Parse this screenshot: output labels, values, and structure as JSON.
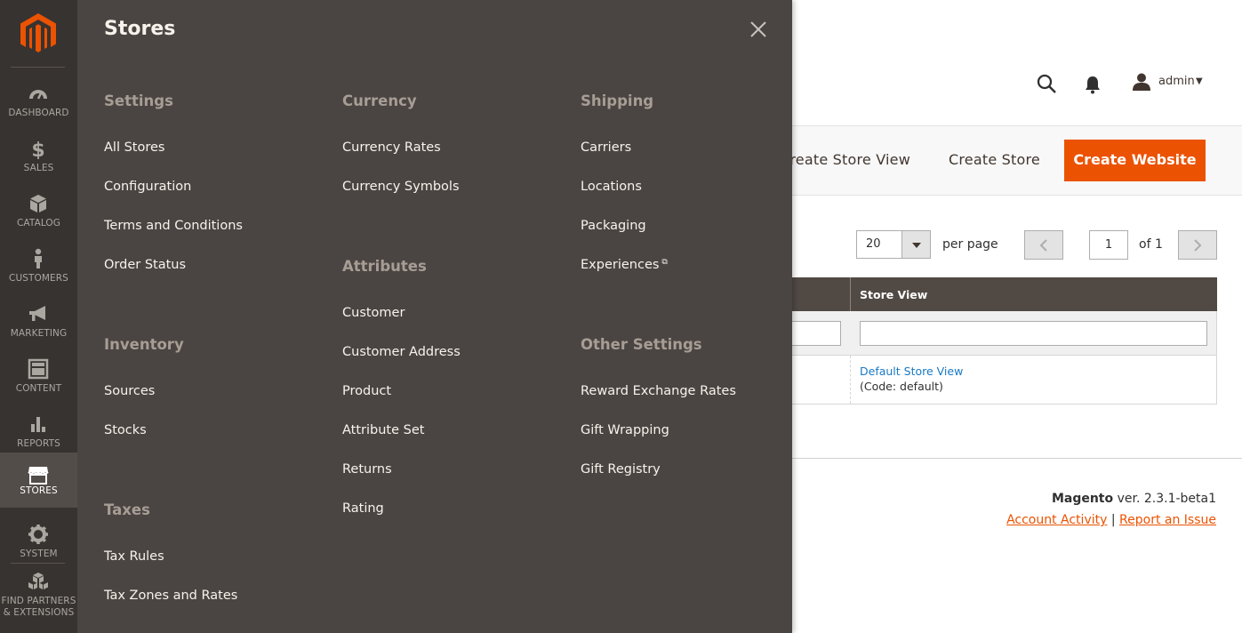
{
  "sidebar": {
    "items": [
      {
        "label": "DASHBOARD",
        "icon": "dashboard-icon"
      },
      {
        "label": "SALES",
        "icon": "dollar-icon"
      },
      {
        "label": "CATALOG",
        "icon": "box-icon"
      },
      {
        "label": "CUSTOMERS",
        "icon": "person-icon"
      },
      {
        "label": "MARKETING",
        "icon": "megaphone-icon"
      },
      {
        "label": "CONTENT",
        "icon": "layout-icon"
      },
      {
        "label": "REPORTS",
        "icon": "bar-chart-icon"
      },
      {
        "label": "STORES",
        "icon": "storefront-icon"
      },
      {
        "label": "SYSTEM",
        "icon": "gear-icon"
      },
      {
        "label_line1": "FIND PARTNERS",
        "label_line2": "& EXTENSIONS",
        "icon": "cubes-icon"
      }
    ]
  },
  "header": {
    "user": "admin"
  },
  "page_actions": {
    "create_store_view": "Create Store View",
    "create_store": "Create Store",
    "create_website": "Create Website"
  },
  "pager": {
    "per_page_value": "20",
    "per_page_label": "per page",
    "current_page": "1",
    "of_pages": "of 1"
  },
  "grid": {
    "column_store_view": "Store View",
    "row": {
      "store_view_name": "Default Store View",
      "store_view_code": "(Code: default)"
    }
  },
  "footer": {
    "brand": "Magento",
    "version": "ver. 2.3.1-beta1",
    "account_activity": "Account Activity",
    "separator": "|",
    "report_issue": "Report an Issue"
  },
  "flyout": {
    "title": "Stores",
    "settings": {
      "title": "Settings",
      "items": [
        "All Stores",
        "Configuration",
        "Terms and Conditions",
        "Order Status"
      ]
    },
    "inventory": {
      "title": "Inventory",
      "items": [
        "Sources",
        "Stocks"
      ]
    },
    "taxes": {
      "title": "Taxes",
      "items": [
        "Tax Rules",
        "Tax Zones and Rates"
      ]
    },
    "currency": {
      "title": "Currency",
      "items": [
        "Currency Rates",
        "Currency Symbols"
      ]
    },
    "attributes": {
      "title": "Attributes",
      "items": [
        "Customer",
        "Customer Address",
        "Product",
        "Attribute Set",
        "Returns",
        "Rating"
      ]
    },
    "shipping": {
      "title": "Shipping",
      "items": [
        "Carriers",
        "Locations",
        "Packaging",
        "Experiences"
      ]
    },
    "other_settings": {
      "title": "Other Settings",
      "items": [
        "Reward Exchange Rates",
        "Gift Wrapping",
        "Gift Registry"
      ]
    }
  },
  "colors": {
    "accent": "#eb5202",
    "sidebar_bg": "#373330",
    "flyout_bg": "#4a4542",
    "grid_header_bg": "#514943",
    "link": "#1979c3"
  }
}
